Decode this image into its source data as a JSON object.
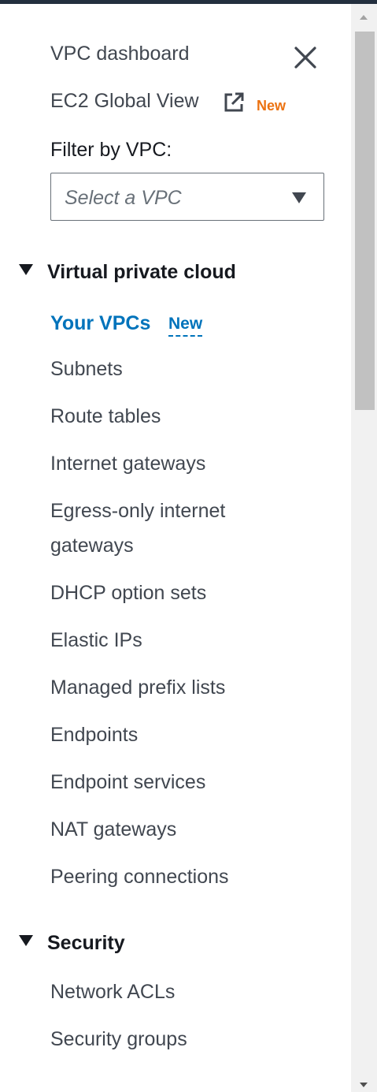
{
  "nav": {
    "dashboard": "VPC dashboard",
    "global_view": "EC2 Global View",
    "global_view_badge": "New",
    "filter_label": "Filter by VPC:",
    "filter_placeholder": "Select a VPC",
    "sections": {
      "vpc": {
        "title": "Virtual private cloud",
        "active_item": "Your VPCs",
        "active_badge": "New",
        "items": [
          "Subnets",
          "Route tables",
          "Internet gateways",
          "Egress-only internet",
          "gateways",
          "DHCP option sets",
          "Elastic IPs",
          "Managed prefix lists",
          "Endpoints",
          "Endpoint services",
          "NAT gateways",
          "Peering connections"
        ]
      },
      "security": {
        "title": "Security",
        "items": [
          "Network ACLs",
          "Security groups"
        ]
      }
    }
  },
  "icons": {
    "close": "close-icon",
    "external_link": "external-link-icon",
    "select_caret": "caret-down-icon",
    "section_toggle": "triangle-down-icon"
  },
  "colors": {
    "link_active": "#0073bb",
    "badge_new": "#ec7211",
    "text": "#414750",
    "header_bar": "#232f3e"
  }
}
